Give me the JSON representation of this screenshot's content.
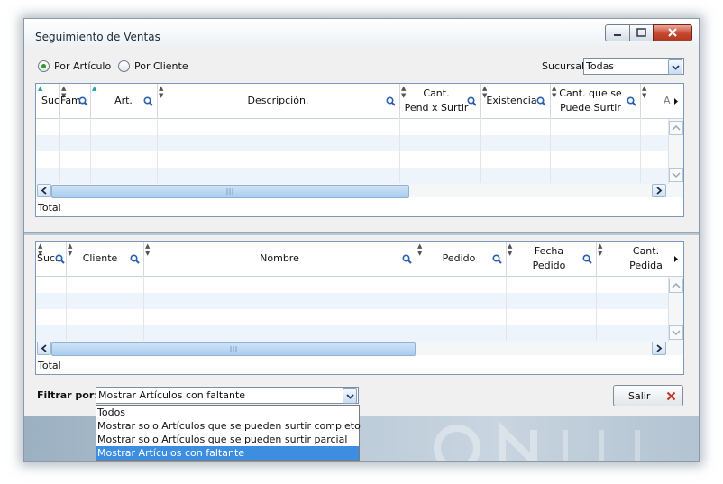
{
  "window": {
    "title": "Seguimiento de Ventas"
  },
  "mode": {
    "options": [
      {
        "label": "Por Artículo",
        "selected": true
      },
      {
        "label": "Por Cliente",
        "selected": false
      }
    ]
  },
  "sucursal": {
    "label": "Sucursal",
    "value": "Todas"
  },
  "grid_top": {
    "columns": [
      {
        "label": "Suc",
        "sort": "asc"
      },
      {
        "label": "Fam",
        "sort": "none"
      },
      {
        "label": "Art.",
        "sort": "asc"
      },
      {
        "label": "Descripción.",
        "sort": "none"
      },
      {
        "label": "Cant.\nPend x Surtir",
        "sort": "none"
      },
      {
        "label": "Existencia",
        "sort": "none"
      },
      {
        "label": "Cant. que se\nPuede Surtir",
        "sort": "none"
      },
      {
        "label": "A",
        "sort": "none"
      }
    ],
    "total_label": "Total"
  },
  "grid_bottom": {
    "columns": [
      {
        "label": "Suc.",
        "sort": "none"
      },
      {
        "label": "Cliente",
        "sort": "none"
      },
      {
        "label": "Nombre",
        "sort": "none"
      },
      {
        "label": "Pedido",
        "sort": "none"
      },
      {
        "label": "Fecha\nPedido",
        "sort": "none"
      },
      {
        "label": "Cant.\nPedida",
        "sort": "none"
      }
    ],
    "total_label": "Total"
  },
  "filter": {
    "label": "Filtrar por:",
    "value": "Mostrar Artículos con faltante",
    "options": [
      {
        "label": "Todos",
        "selected": false
      },
      {
        "label": "Mostrar solo Artículos que se pueden surtir completo",
        "selected": false
      },
      {
        "label": "Mostrar solo Artículos que se pueden surtir parcial",
        "selected": false
      },
      {
        "label": "Mostrar Artículos con faltante",
        "selected": true
      }
    ]
  },
  "actions": {
    "exit_label": "Salir"
  },
  "colors": {
    "accent": "#3d8ee0",
    "close_icon": "#c0392b",
    "radio_on": "#2f9a2f"
  },
  "icons": {
    "column_search": "magnifier-icon",
    "exit": "close-x-icon",
    "sort": "sort-arrows-icon"
  }
}
